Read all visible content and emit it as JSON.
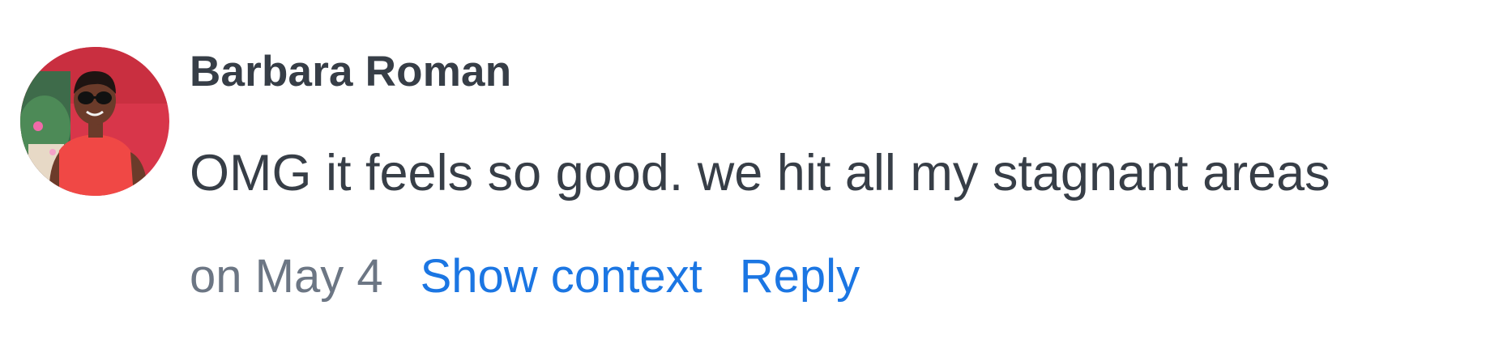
{
  "comment": {
    "author": "Barbara Roman",
    "avatar_icon": "user-avatar-photo",
    "text": "OMG it feels so good. we hit all my stagnant areas",
    "date": "on May 4",
    "actions": {
      "show_context": "Show context",
      "reply": "Reply"
    }
  },
  "colors": {
    "text": "#373e47",
    "muted": "#6c7684",
    "link": "#1b76e3"
  }
}
